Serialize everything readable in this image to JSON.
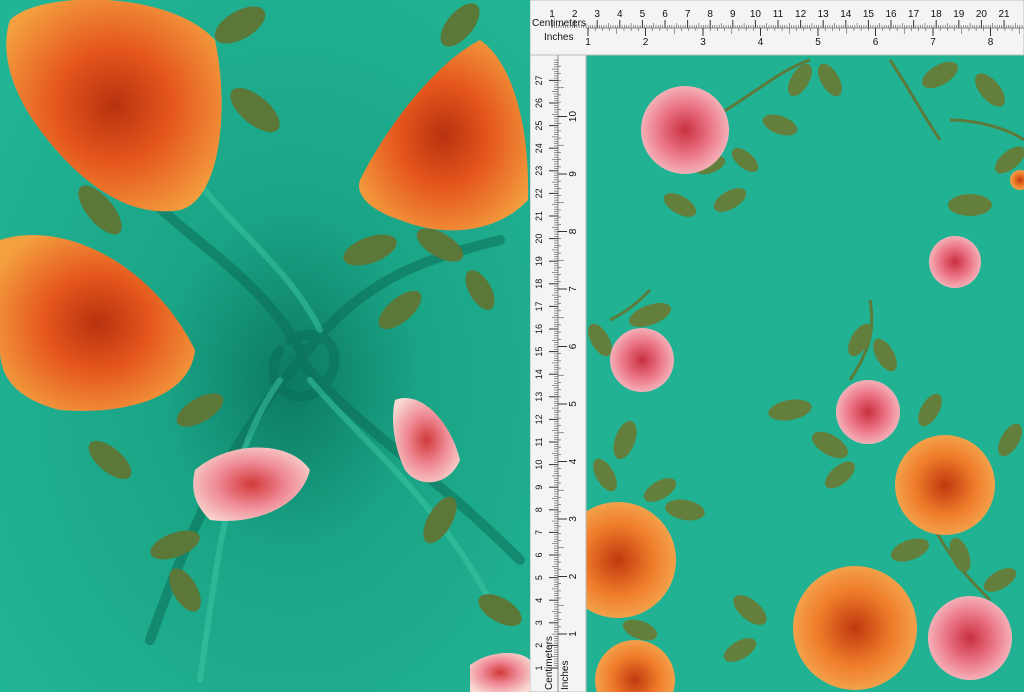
{
  "colors": {
    "fabric": "#1fae90",
    "fabric_dark": "#128f74",
    "rose_orange": "#f08a2c",
    "rose_red": "#d8471a",
    "rose_pink": "#ef7d8a",
    "leaf": "#5f7a3c",
    "ruler_bg": "#f4f4f4"
  },
  "ruler": {
    "top_units_label": "Centimeters",
    "bottom_units_label": "Inches",
    "left_units_label_a": "Centimeters",
    "left_units_label_b": "Inches",
    "cm_ticks": [
      "1",
      "2",
      "3",
      "4",
      "5",
      "6",
      "7",
      "8",
      "9",
      "10",
      "11",
      "12",
      "13",
      "14",
      "15",
      "16",
      "17",
      "18",
      "19",
      "20",
      "21"
    ],
    "in_ticks": [
      "1",
      "2",
      "3",
      "4",
      "5",
      "6",
      "7",
      "8"
    ],
    "v_cm_ticks": [
      "1",
      "2",
      "3",
      "4",
      "5",
      "6",
      "7",
      "8",
      "9",
      "10",
      "11",
      "12",
      "13",
      "14",
      "15",
      "16",
      "17",
      "18",
      "19",
      "20",
      "21",
      "22",
      "23",
      "24",
      "25",
      "26",
      "27"
    ],
    "v_in_ticks": [
      "1",
      "2",
      "3",
      "4",
      "5",
      "6",
      "7",
      "8",
      "9",
      "10"
    ]
  }
}
